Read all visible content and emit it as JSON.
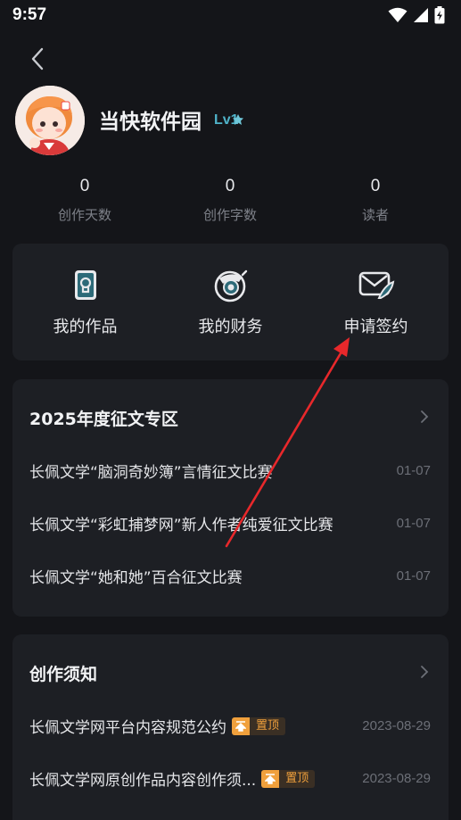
{
  "status_bar": {
    "time": "9:57"
  },
  "profile": {
    "name": "当快软件园",
    "level_badge": "Lv1"
  },
  "stats": [
    {
      "value": "0",
      "label": "创作天数"
    },
    {
      "value": "0",
      "label": "创作字数"
    },
    {
      "value": "0",
      "label": "读者"
    }
  ],
  "tools": [
    {
      "label": "我的作品",
      "icon": "works-icon"
    },
    {
      "label": "我的财务",
      "icon": "finance-icon"
    },
    {
      "label": "申请签约",
      "icon": "contract-icon"
    }
  ],
  "contest": {
    "title": "2025年度征文专区",
    "items": [
      {
        "title": "长佩文学“脑洞奇妙簿”言情征文比赛",
        "date": "01-07"
      },
      {
        "title": "长佩文学“彩虹捕梦网”新人作者纯爱征文比赛",
        "date": "01-07"
      },
      {
        "title": "长佩文学“她和她”百合征文比赛",
        "date": "01-07"
      }
    ]
  },
  "guide": {
    "title": "创作须知",
    "items": [
      {
        "title": "长佩文学网平台内容规范公约",
        "pin": "置顶",
        "date": "2023-08-29"
      },
      {
        "title": "长佩文学网原创作品内容创作须...",
        "pin": "置顶",
        "date": "2023-08-29"
      }
    ]
  },
  "colors": {
    "background": "#141519",
    "card": "#1d1f24",
    "annotation_arrow": "#e8282b",
    "pin": "#f0a03c"
  }
}
